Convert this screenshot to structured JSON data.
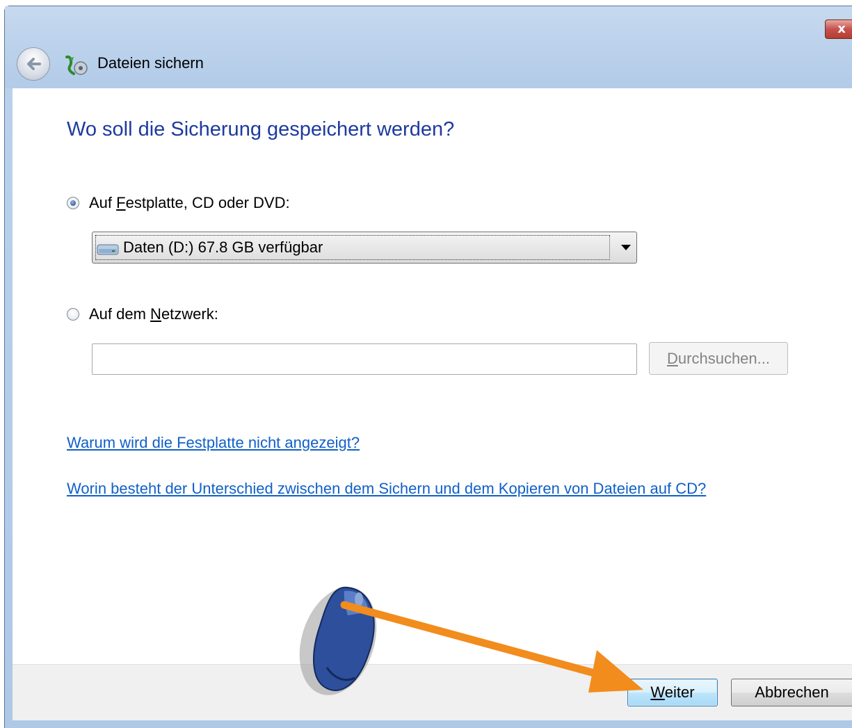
{
  "window": {
    "title": "Dateien sichern",
    "close_label": "x"
  },
  "heading": "Wo soll die Sicherung gespeichert werden?",
  "option_local": {
    "label_before": "Auf ",
    "label_accel": "F",
    "label_after": "estplatte, CD oder DVD:",
    "selected": true
  },
  "drive_select": {
    "value": "Daten (D:)  67.8 GB verfügbar"
  },
  "option_network": {
    "label_before": "Auf dem ",
    "label_accel": "N",
    "label_after": "etzwerk:",
    "selected": false
  },
  "network_path": {
    "value": ""
  },
  "browse_button": {
    "accel": "D",
    "label_rest": "urchsuchen..."
  },
  "links": {
    "why_no_disk": "Warum wird die Festplatte nicht angezeigt?",
    "difference": "Worin besteht der Unterschied zwischen dem Sichern und dem Kopieren von Dateien auf CD?"
  },
  "footer": {
    "next_accel": "W",
    "next_rest": "eiter",
    "cancel_label": "Abbrechen"
  },
  "colors": {
    "heading": "#1e3aa0",
    "link": "#1060c8",
    "annotation_arrow": "#f28c1c"
  }
}
